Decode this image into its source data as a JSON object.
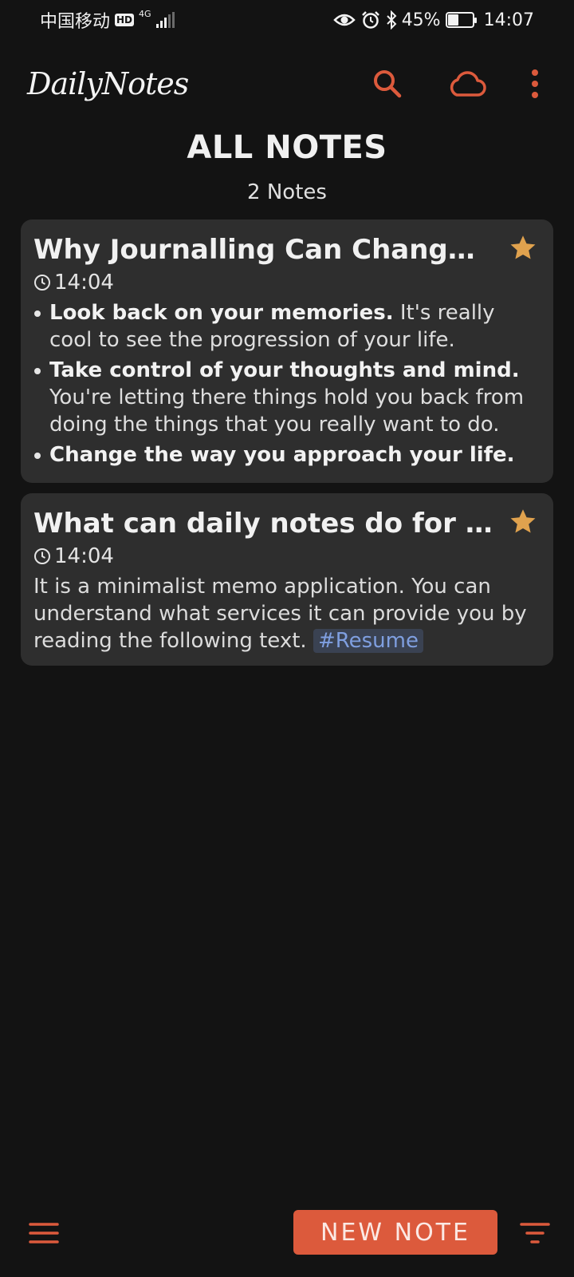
{
  "status_bar": {
    "carrier": "中国移动",
    "hd": "HD",
    "network": "4G",
    "battery": "45%",
    "battery_level": 0.45,
    "time": "14:07"
  },
  "app": {
    "logo": "DailyNotes",
    "accent_color": "#dc5a3c",
    "actions": [
      "search-icon",
      "cloud-icon",
      "more-vertical-icon"
    ]
  },
  "header": {
    "title": "ALL NOTES",
    "count": "2 Notes"
  },
  "notes": [
    {
      "title": "Why Journalling Can Change Y...",
      "starred": true,
      "time": "14:04",
      "bullets": [
        {
          "bold": "Look back on your memories.",
          "text": " It's really cool to see the progression of your life."
        },
        {
          "bold": "Take control of your thoughts and mind.",
          "text": " You're letting there things hold you back from doing the things that you really want to do."
        },
        {
          "bold": "Change the way you approach your life.",
          "text": ""
        }
      ]
    },
    {
      "title": "What can daily notes do for you?",
      "starred": true,
      "time": "14:04",
      "body": "It is a minimalist memo application. You can understand what services it can provide you by reading the following text. ",
      "tag": "#Resume"
    }
  ],
  "bottom": {
    "new_note": "NEW NOTE"
  }
}
